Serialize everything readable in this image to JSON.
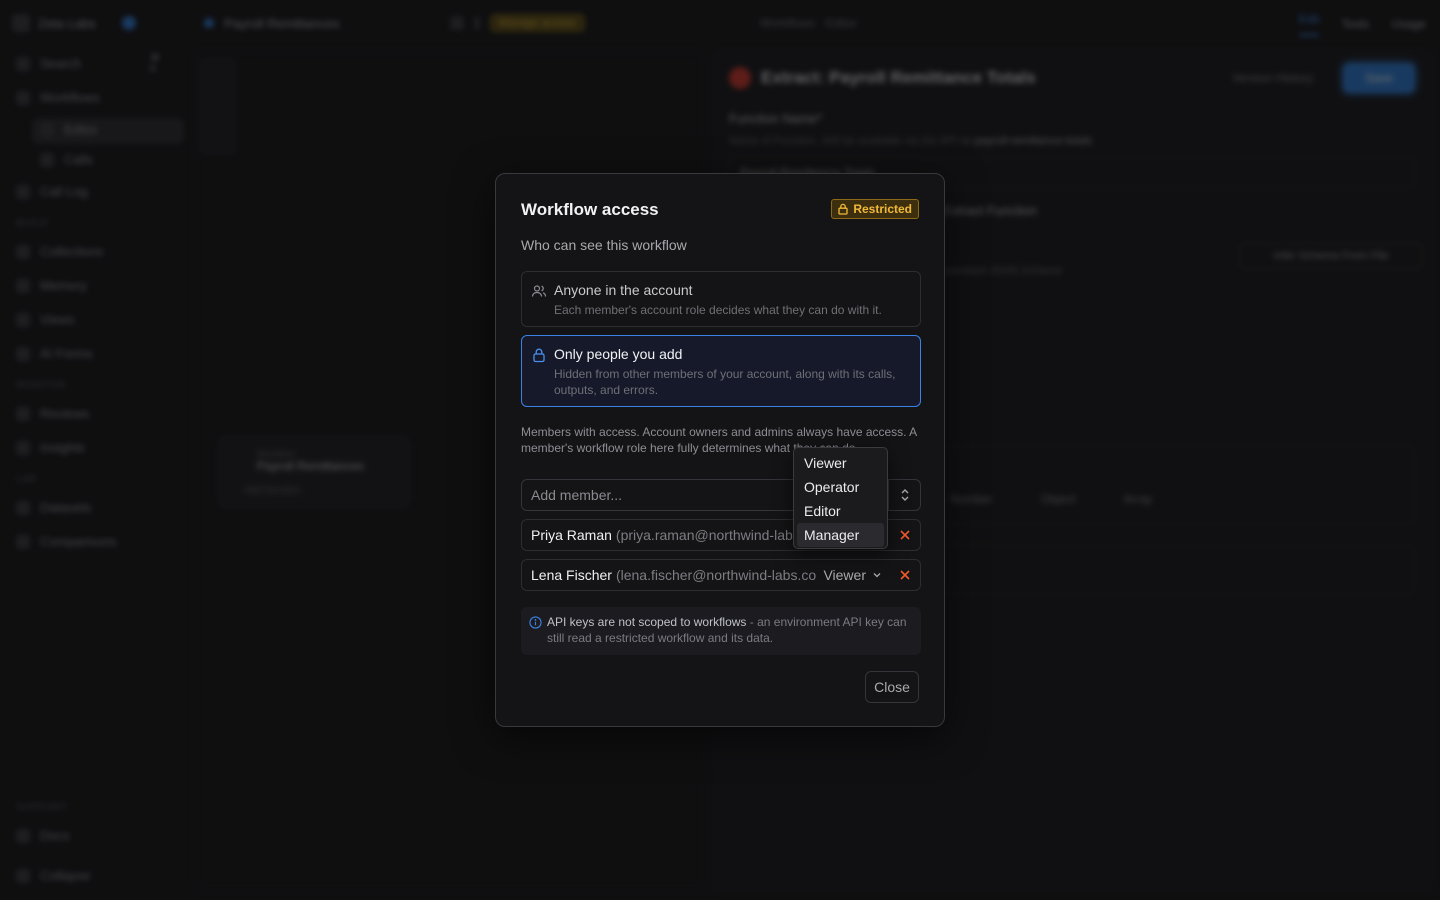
{
  "background": {
    "topbar": {
      "workspace": "Zeta Labs",
      "workflow": "Payroll Remittances",
      "badge": "Manage access",
      "center": "Workflows · Editor",
      "tabs": [
        "Edit",
        "Tests",
        "Usage"
      ]
    },
    "sidebar": {
      "items": [
        {
          "label": "Search",
          "kbd": "⌘ K"
        },
        {
          "label": "Workflows"
        },
        {
          "label": "Editor"
        },
        {
          "label": "Calls"
        },
        {
          "label": "Call Log"
        }
      ],
      "section_build": "BUILD",
      "build_items": [
        "Collections",
        "Memory",
        "Views",
        "AI Forms"
      ],
      "section_monitor": "MONITOR",
      "monitor_items": [
        "Reviews",
        "Insights"
      ],
      "section_lab": "LAB",
      "lab_items": [
        "Datasets",
        "Comparisons"
      ],
      "section_support": "SUPPORT",
      "support_items": [
        "Docs",
        "Collapse"
      ]
    },
    "canvas_node": {
      "caption": "Workflow",
      "title": "Payroll Remittances",
      "sub": "Add function"
    },
    "panel": {
      "title": "Extract: Payroll Remittance Totals",
      "version_history": "Version History",
      "save": "Save",
      "function_name_label": "Function Name*",
      "function_name_help": "Name of Function. Will be available via the API as",
      "function_name_slug": "payroll-remittance-totals",
      "function_name_value": "Payroll Remittance Totals",
      "type_label": "Extract Function",
      "infer_button": "Infer Schema From File",
      "schema_hint": "standard JSON Schema",
      "types": [
        "Number",
        "Object",
        "Array"
      ]
    }
  },
  "modal": {
    "title": "Workflow access",
    "badge": "Restricted",
    "subtitle": "Who can see this workflow",
    "options": [
      {
        "title": "Anyone in the account",
        "desc": "Each member's account role decides what they can do with it.",
        "selected": false
      },
      {
        "title": "Only people you add",
        "desc": "Hidden from other members of your account, along with its calls, outputs, and errors.",
        "selected": true
      }
    ],
    "note": "Members with access. Account owners and admins always have access. A member's workflow role here fully determines what they can do.",
    "add_placeholder": "Add member...",
    "members": [
      {
        "name": "Priya Raman",
        "email": "(priya.raman@northwind-labs.com)",
        "role": "Manager"
      },
      {
        "name": "Lena Fischer",
        "email": "(lena.fischer@northwind-labs.com)",
        "role": "Viewer"
      }
    ],
    "role_options": [
      "Viewer",
      "Operator",
      "Editor",
      "Manager"
    ],
    "info_strong": "API keys are not scoped to workflows",
    "info_rest": " - an environment API key can still read a restricted workflow and its data.",
    "close": "Close"
  },
  "colors": {
    "accent": "#3b82e6",
    "restricted": "#f1b93a",
    "danger": "#ef5a2a"
  }
}
